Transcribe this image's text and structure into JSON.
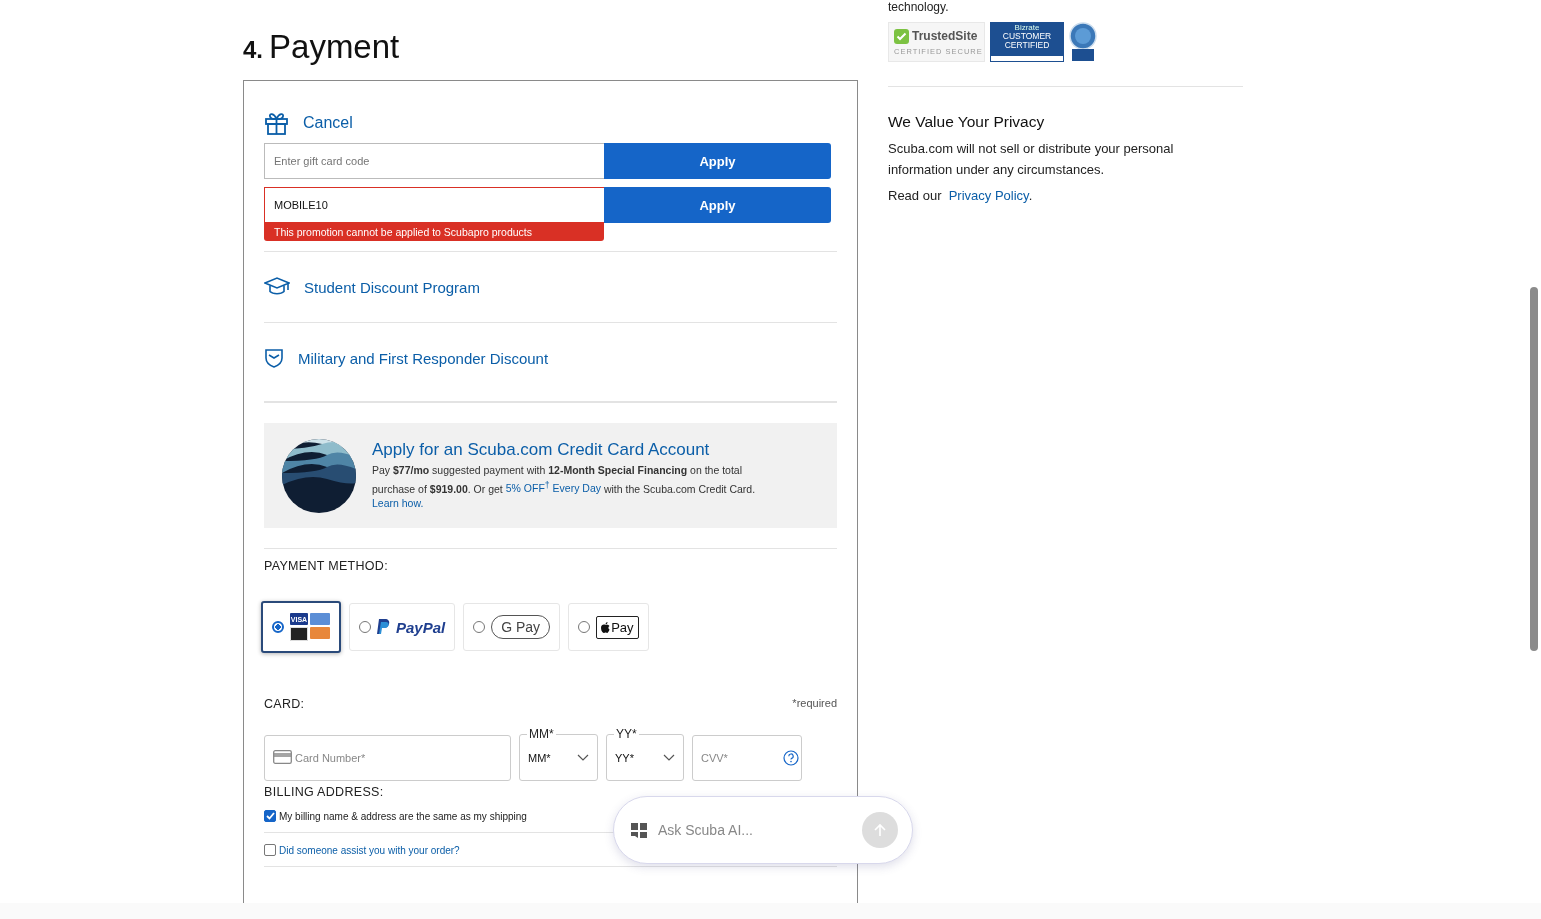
{
  "heading": {
    "number": "4.",
    "title": "Payment"
  },
  "gift_card": {
    "toggle_label": "Cancel",
    "placeholder": "Enter gift card code",
    "button": "Apply"
  },
  "promo_code": {
    "value": "MOBILE10",
    "button": "Apply",
    "error": "This promotion cannot be applied to Scubapro products"
  },
  "discount_links": [
    {
      "kind": "student",
      "label": "Student Discount Program"
    },
    {
      "kind": "military",
      "label": "Military and First Responder Discount"
    }
  ],
  "credit_offer": {
    "title": "Apply for an Scuba.com Credit Card Account",
    "segments": [
      {
        "kind": "plain",
        "text": "Pay **$77/mo** suggested payment with **12-Month Special Financing** on the total purchase of **$919.00**. Or get "
      },
      {
        "kind": "link",
        "text": "5% OFF$^{†}$ Every Day"
      },
      {
        "kind": "plain",
        "text": " with the Scuba.com Credit Card. "
      },
      {
        "kind": "link",
        "text": "Learn how."
      }
    ]
  },
  "payment_method": {
    "label": "PAYMENT METHOD:",
    "options": [
      {
        "kind": "card",
        "label": "VISA",
        "selected": true
      },
      {
        "kind": "paypal",
        "label": "PayPal",
        "selected": false
      },
      {
        "kind": "gpay",
        "label": "G Pay",
        "selected": false
      },
      {
        "kind": "applepay",
        "label": "Pay",
        "selected": false
      }
    ]
  },
  "card": {
    "label": "CARD:",
    "required_note": "*required",
    "number_placeholder": "Card Number*",
    "month": {
      "label": "MM*",
      "value": "MM*"
    },
    "year": {
      "label": "YY*",
      "value": "YY*"
    },
    "cvv_placeholder": "CVV*"
  },
  "billing": {
    "label": "BILLING ADDRESS:",
    "checkboxes": [
      {
        "kind": "plain",
        "label": "My billing name & address are the same as my shipping",
        "checked": true
      },
      {
        "kind": "link",
        "label": "Did someone assist you with your order?",
        "checked": false
      }
    ]
  },
  "sidebar": {
    "cut_text": "technology.",
    "trusted_badge": {
      "name": "TrustedSite",
      "caption": "CERTIFIED SECURE"
    },
    "bizrate_badge": {
      "top": "Bizrate",
      "title": "CUSTOMER CERTIFIED"
    },
    "privacy": {
      "title": "We Value Your Privacy",
      "body": "Scuba.com will not sell or distribute your personal information under any circumstances.",
      "read_prefix": "Read our",
      "link": "Privacy Policy",
      "suffix": "."
    }
  },
  "chat": {
    "placeholder": "Ask Scuba AI..."
  }
}
